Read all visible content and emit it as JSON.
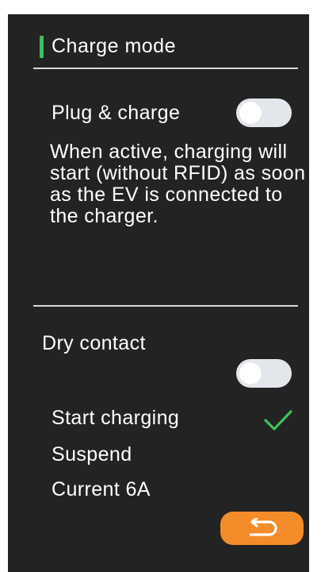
{
  "header": {
    "title": "Charge mode"
  },
  "plug_charge": {
    "label": "Plug & charge",
    "toggle_state": "off",
    "description": "When active, charging will start (without RFID) as soon as the EV is connected to the charger."
  },
  "dry_contact": {
    "label": "Dry contact",
    "toggle_state": "off",
    "options": [
      {
        "label": "Start charging",
        "selected": true
      },
      {
        "label": "Suspend",
        "selected": false
      },
      {
        "label": "Current 6A",
        "selected": false
      }
    ]
  },
  "icons": {
    "check": "check-icon",
    "back": "back-icon"
  },
  "colors": {
    "background": "#232323",
    "accent": "#3fbf5a",
    "back_button": "#f48c2a",
    "toggle_track": "#e3e7ec"
  }
}
